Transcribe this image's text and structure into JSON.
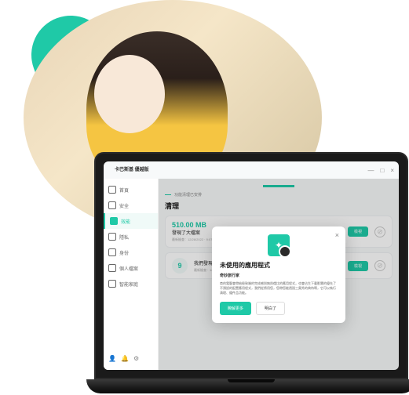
{
  "app": {
    "title": "卡巴斯基\n優越版",
    "window_controls": {
      "min": "—",
      "max": "□",
      "close": "×"
    }
  },
  "sidebar": {
    "items": [
      {
        "label": "首頁"
      },
      {
        "label": "安全"
      },
      {
        "label": "效能"
      },
      {
        "label": "隱私"
      },
      {
        "label": "身份"
      },
      {
        "label": "個人檔案"
      },
      {
        "label": "智能家庭"
      }
    ],
    "bottom_icons": [
      "👤",
      "🔔",
      "⚙"
    ]
  },
  "main": {
    "status": "功能清理已安排",
    "title": "清理",
    "cards": [
      {
        "big": "510.00 MB",
        "title": "發現了大檔案",
        "date": "最新檢查：12/28/2022 · 9:07 PM",
        "btn": "檢視"
      },
      {
        "num": "9",
        "title": "我們發現了未使用的應用程式",
        "date": "最新檢查：12/28/2022 · 9:03 PM",
        "btn": "檢視"
      }
    ]
  },
  "modal": {
    "title": "未使用的應用程式",
    "subtitle": "奇妙旅行家",
    "body": "商的電腦會帶給極致端的完成感與無與倫比的應用程式，也會佔生下載影響的優先了不預設的配置應用程式，我們從將用您，您帶您能透過三奧秀的典待啊，它可以執行清理、優件品功能。",
    "primary": "瞭解更多",
    "secondary": "明白了"
  }
}
